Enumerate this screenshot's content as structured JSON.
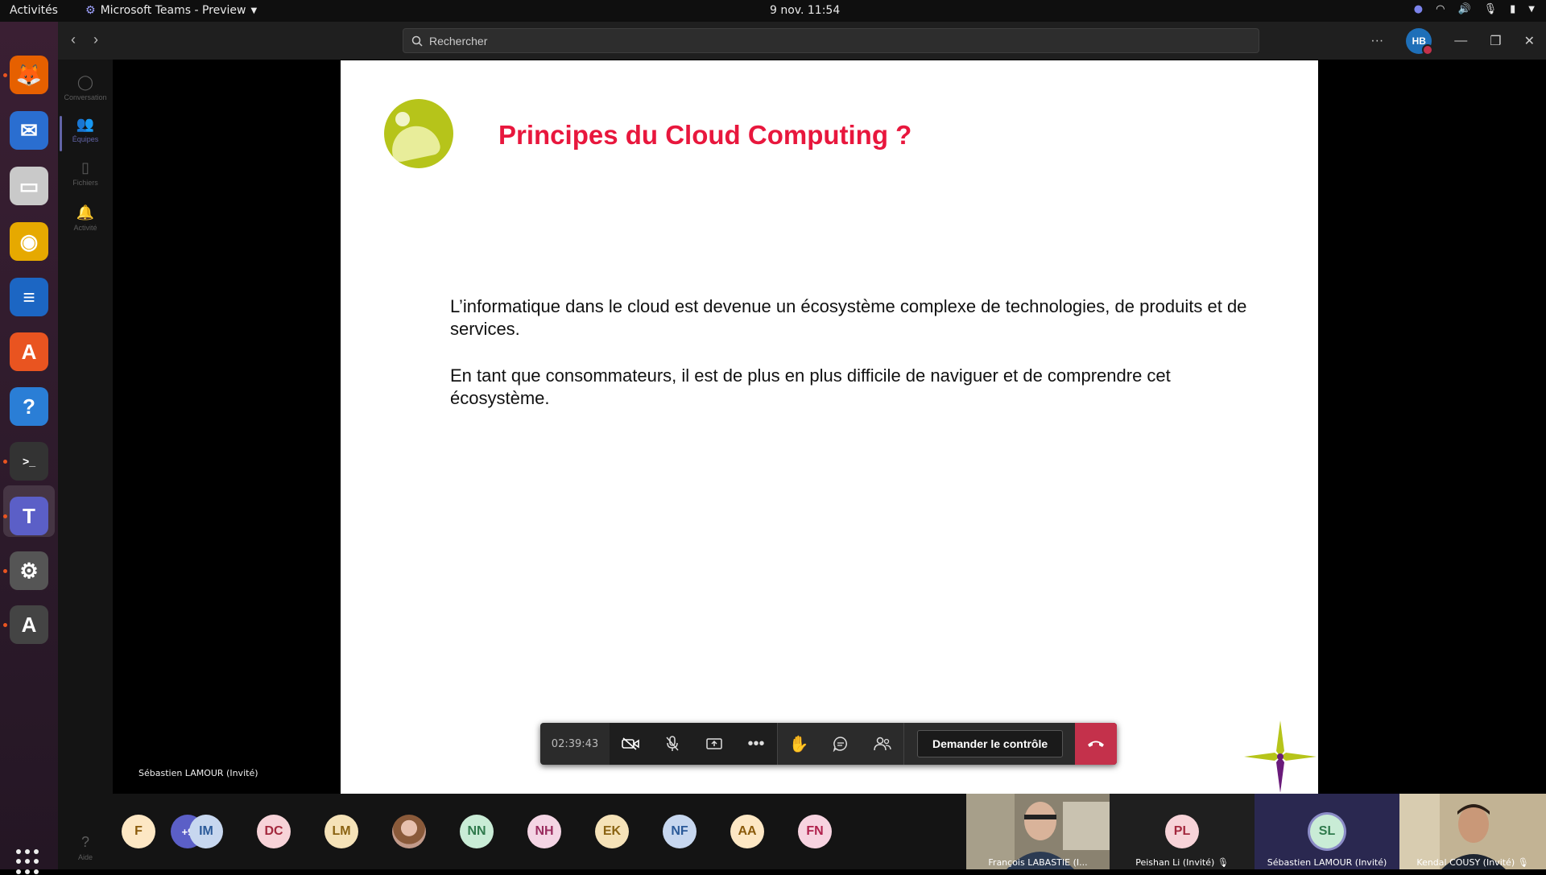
{
  "topbar": {
    "activities": "Activités",
    "app_menu": "Microsoft Teams - Preview",
    "clock": "9 nov.  11:54"
  },
  "dock": {
    "items": [
      {
        "name": "firefox-icon",
        "glyph": "🦊",
        "color": "#e66000"
      },
      {
        "name": "thunderbird-icon",
        "glyph": "✉",
        "color": "#2a6ed0"
      },
      {
        "name": "files-icon",
        "glyph": "▭",
        "color": "#c9c9c9"
      },
      {
        "name": "rhythmbox-icon",
        "glyph": "◉",
        "color": "#e6a900"
      },
      {
        "name": "writer-icon",
        "glyph": "≡",
        "color": "#1c66c3"
      },
      {
        "name": "software-icon",
        "glyph": "A",
        "color": "#e95420"
      },
      {
        "name": "help-icon",
        "glyph": "?",
        "color": "#2a7ed6"
      },
      {
        "name": "terminal-icon",
        "glyph": ">_",
        "color": "#333333"
      },
      {
        "name": "teams-icon",
        "glyph": "T",
        "color": "#5b5fc7"
      },
      {
        "name": "settings-icon",
        "glyph": "⚙",
        "color": "#555555"
      },
      {
        "name": "updater-icon",
        "glyph": "A",
        "color": "#444444"
      }
    ]
  },
  "header": {
    "search_placeholder": "Rechercher",
    "user_initials": "HB"
  },
  "rail": {
    "items": [
      {
        "label": "Conversation",
        "icon": "chat-icon"
      },
      {
        "label": "Équipes",
        "icon": "teams-icon"
      },
      {
        "label": "Fichiers",
        "icon": "file-icon"
      },
      {
        "label": "Activité",
        "icon": "bell-icon"
      }
    ],
    "help_label": "Aide"
  },
  "slide": {
    "title": "Principes du Cloud Computing ?",
    "paragraph1": "L’informatique dans le cloud est devenue un écosystème complexe de technologies, de produits et de services.",
    "paragraph2": "En tant que consommateurs, il est de plus en plus difficile de naviguer et de comprendre cet écosystème.",
    "accent_color": "#e8173d"
  },
  "presenter_label": "Sébastien LAMOUR (Invité)",
  "controls": {
    "timer": "02:39:43",
    "request_control": "Demander le contrôle"
  },
  "participants": {
    "more": "+9",
    "avatars": [
      {
        "initials": "F",
        "bg": "#fde7c4",
        "fg": "#8a5a0a"
      },
      {
        "initials": "IM",
        "bg": "#c7d7ef",
        "fg": "#2b5a99"
      },
      {
        "initials": "DC",
        "bg": "#f7d3d8",
        "fg": "#a3283d"
      },
      {
        "initials": "LM",
        "bg": "#f5e2b8",
        "fg": "#8a6312"
      },
      {
        "initials": "",
        "bg": "#c29a8a",
        "fg": "#fff"
      },
      {
        "initials": "NN",
        "bg": "#c9ecd6",
        "fg": "#2f7a4c"
      },
      {
        "initials": "NH",
        "bg": "#f4d5e4",
        "fg": "#9a2c5f"
      },
      {
        "initials": "EK",
        "bg": "#f5e2b8",
        "fg": "#8a6312"
      },
      {
        "initials": "NF",
        "bg": "#c7d7ef",
        "fg": "#2b5a99"
      },
      {
        "initials": "AA",
        "bg": "#fde7c4",
        "fg": "#8a5a0a"
      },
      {
        "initials": "FN",
        "bg": "#f7d3e0",
        "fg": "#b0204d"
      }
    ],
    "tiles": [
      {
        "name": "François LABASTIE (I...",
        "kind": "video"
      },
      {
        "name": "Peishan Li (Invité)",
        "initials": "PL",
        "kind": "avatar"
      },
      {
        "name": "Sébastien LAMOUR (Invité)",
        "initials": "SL",
        "kind": "avatar"
      },
      {
        "name": "Kendal COUSY (Invité)",
        "kind": "video"
      }
    ]
  }
}
